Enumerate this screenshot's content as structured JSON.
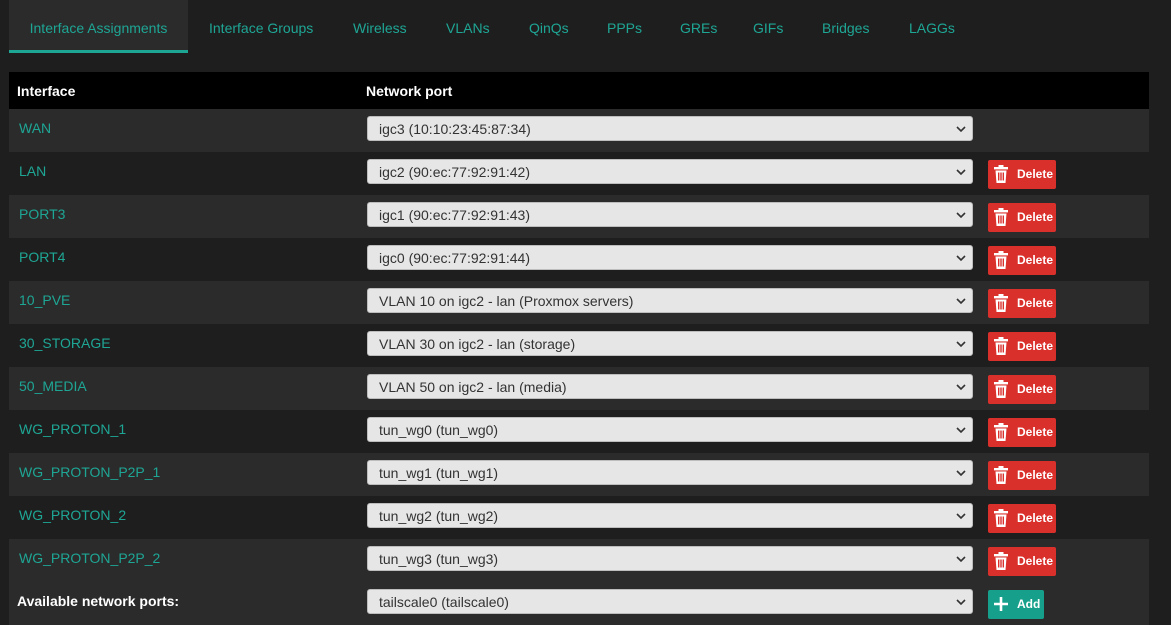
{
  "tabs": [
    {
      "label": "Interface Assignments",
      "active": true
    },
    {
      "label": "Interface Groups"
    },
    {
      "label": "Wireless"
    },
    {
      "label": "VLANs"
    },
    {
      "label": "QinQs"
    },
    {
      "label": "PPPs"
    },
    {
      "label": "GREs"
    },
    {
      "label": "GIFs"
    },
    {
      "label": "Bridges"
    },
    {
      "label": "LAGGs"
    }
  ],
  "table": {
    "header_interface": "Interface",
    "header_port": "Network port",
    "delete_label": "Delete",
    "rows": [
      {
        "name": "WAN",
        "port": "igc3 (10:10:23:45:87:34)"
      },
      {
        "name": "LAN",
        "port": "igc2 (90:ec:77:92:91:42)"
      },
      {
        "name": "PORT3",
        "port": "igc1 (90:ec:77:92:91:43)"
      },
      {
        "name": "PORT4",
        "port": "igc0 (90:ec:77:92:91:44)"
      },
      {
        "name": "10_PVE",
        "port": "VLAN 10 on igc2 - lan (Proxmox servers)"
      },
      {
        "name": "30_STORAGE",
        "port": "VLAN 30 on igc2 - lan (storage)"
      },
      {
        "name": "50_MEDIA",
        "port": "VLAN 50 on igc2 - lan (media)"
      },
      {
        "name": "WG_PROTON_1",
        "port": "tun_wg0 (tun_wg0)"
      },
      {
        "name": "WG_PROTON_P2P_1",
        "port": "tun_wg1 (tun_wg1)"
      },
      {
        "name": "WG_PROTON_2",
        "port": "tun_wg2 (tun_wg2)"
      },
      {
        "name": "WG_PROTON_P2P_2",
        "port": "tun_wg3 (tun_wg3)"
      }
    ],
    "available": {
      "label": "Available network ports:",
      "port": "tailscale0 (tailscale0)",
      "add_label": "Add"
    }
  },
  "colors": {
    "accent": "#1ea695",
    "delete": "#d9302c",
    "add": "#16a08c"
  },
  "icons": {
    "delete": "trash-icon",
    "add": "plus-icon",
    "select": "chevron-down-icon"
  }
}
